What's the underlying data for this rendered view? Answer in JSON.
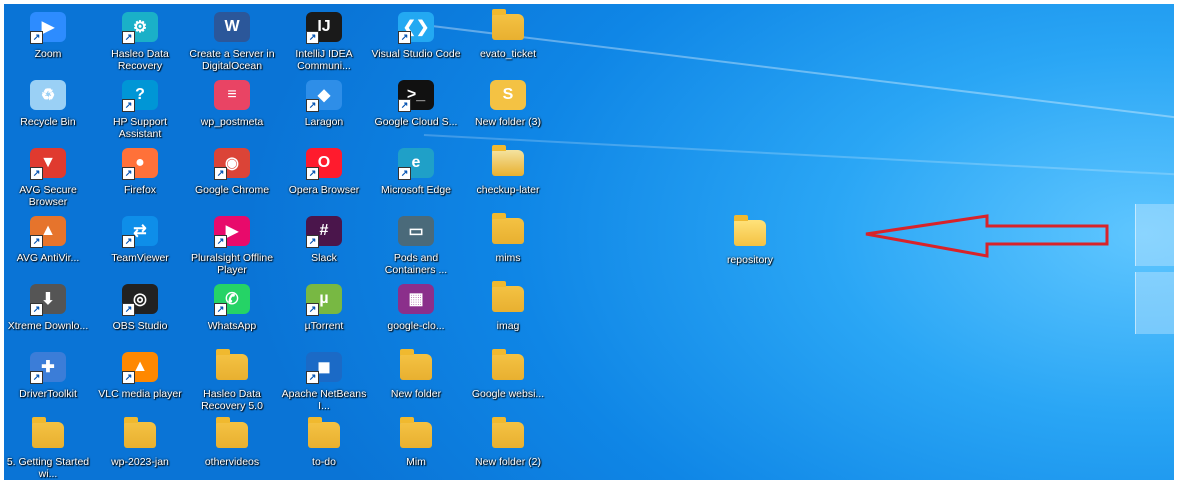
{
  "desktop": {
    "icons": [
      {
        "label": "Zoom",
        "icon": "zoom-icon",
        "color": "#2d8cff",
        "shortcut": true
      },
      {
        "label": "Hasleo Data Recovery",
        "icon": "hasleo-icon",
        "color": "#1ab0c8",
        "shortcut": true
      },
      {
        "label": "Create a Server in DigitalOcean",
        "icon": "word-doc-icon",
        "color": "#2b579a",
        "shortcut": false
      },
      {
        "label": "IntelliJ IDEA Communi...",
        "icon": "intellij-icon",
        "color": "#1a1a1a",
        "shortcut": true
      },
      {
        "label": "Visual Studio Code",
        "icon": "vscode-icon",
        "color": "#23a9f2",
        "shortcut": true
      },
      {
        "label": "evato_ticket",
        "icon": "folder-icon",
        "color": "#f4c243",
        "shortcut": false
      },
      {
        "label": "Recycle Bin",
        "icon": "recycle-bin-icon",
        "color": "#9ad0f5",
        "shortcut": false
      },
      {
        "label": "HP Support Assistant",
        "icon": "help-icon",
        "color": "#0096d6",
        "shortcut": true
      },
      {
        "label": "wp_postmeta",
        "icon": "database-icon",
        "color": "#e94464",
        "shortcut": false
      },
      {
        "label": "Laragon",
        "icon": "laragon-icon",
        "color": "#2e8ee8",
        "shortcut": true
      },
      {
        "label": "Google Cloud S...",
        "icon": "terminal-icon",
        "color": "#111111",
        "shortcut": true
      },
      {
        "label": "New folder (3)",
        "icon": "sublime-folder-icon",
        "color": "#f4c243",
        "shortcut": false
      },
      {
        "label": "AVG Secure Browser",
        "icon": "avg-browser-icon",
        "color": "#e03a2f",
        "shortcut": true
      },
      {
        "label": "Firefox",
        "icon": "firefox-icon",
        "color": "#ff7139",
        "shortcut": true
      },
      {
        "label": "Google Chrome",
        "icon": "chrome-icon",
        "color": "#db4437",
        "shortcut": true
      },
      {
        "label": "Opera Browser",
        "icon": "opera-icon",
        "color": "#ff1b2d",
        "shortcut": true
      },
      {
        "label": "Microsoft Edge",
        "icon": "edge-icon",
        "color": "#1fa0c8",
        "shortcut": true
      },
      {
        "label": "checkup-later",
        "icon": "folder-icon",
        "color": "#f4e3a0",
        "shortcut": false
      },
      {
        "label": "AVG AntiVir...",
        "icon": "avg-antivirus-icon",
        "color": "#e6742c",
        "shortcut": true
      },
      {
        "label": "TeamViewer",
        "icon": "teamviewer-icon",
        "color": "#0e8ee9",
        "shortcut": true
      },
      {
        "label": "Pluralsight Offline Player",
        "icon": "pluralsight-icon",
        "color": "#e80a6b",
        "shortcut": true
      },
      {
        "label": "Slack",
        "icon": "slack-icon",
        "color": "#4a154b",
        "shortcut": true
      },
      {
        "label": "Pods and Containers ...",
        "icon": "video-file-icon",
        "color": "#4a6a7a",
        "shortcut": false
      },
      {
        "label": "mims",
        "icon": "folder-icon",
        "color": "#f4c243",
        "shortcut": false
      },
      {
        "label": "Xtreme Downlo...",
        "icon": "download-icon",
        "color": "#555555",
        "shortcut": true
      },
      {
        "label": "OBS Studio",
        "icon": "obs-icon",
        "color": "#222222",
        "shortcut": true
      },
      {
        "label": "WhatsApp",
        "icon": "whatsapp-icon",
        "color": "#25d366",
        "shortcut": true
      },
      {
        "label": "µTorrent",
        "icon": "utorrent-icon",
        "color": "#78b843",
        "shortcut": true
      },
      {
        "label": "google-clo...",
        "icon": "winrar-icon",
        "color": "#8b2f8b",
        "shortcut": false
      },
      {
        "label": "imag",
        "icon": "folder-icon",
        "color": "#f4c243",
        "shortcut": false
      },
      {
        "label": "DriverToolkit",
        "icon": "drivertoolkit-icon",
        "color": "#3b7dd8",
        "shortcut": true
      },
      {
        "label": "VLC media player",
        "icon": "vlc-icon",
        "color": "#ff8800",
        "shortcut": true
      },
      {
        "label": "Hasleo Data Recovery 5.0",
        "icon": "folder-icon",
        "color": "#f4c243",
        "shortcut": false
      },
      {
        "label": "Apache NetBeans I...",
        "icon": "netbeans-icon",
        "color": "#1b6ac6",
        "shortcut": true
      },
      {
        "label": "New folder",
        "icon": "folder-icon",
        "color": "#f4c243",
        "shortcut": false
      },
      {
        "label": "Google websi...",
        "icon": "folder-icon",
        "color": "#f4c243",
        "shortcut": false
      },
      {
        "label": "5. Getting Started wi...",
        "icon": "folder-icon",
        "color": "#f4c243",
        "shortcut": false
      },
      {
        "label": "wp-2023-jan",
        "icon": "folder-icon",
        "color": "#f4c243",
        "shortcut": false
      },
      {
        "label": "othervideos",
        "icon": "folder-icon",
        "color": "#f4c243",
        "shortcut": false
      },
      {
        "label": "to-do",
        "icon": "folder-icon",
        "color": "#f4c243",
        "shortcut": false
      },
      {
        "label": "Mim",
        "icon": "folder-icon",
        "color": "#f4c243",
        "shortcut": false
      },
      {
        "label": "New folder (2)",
        "icon": "folder-icon",
        "color": "#f4c243",
        "shortcut": false
      }
    ],
    "highlighted_folder": {
      "label": "repository",
      "icon": "folder-icon"
    },
    "annotation_arrow_color": "#d8232a"
  }
}
